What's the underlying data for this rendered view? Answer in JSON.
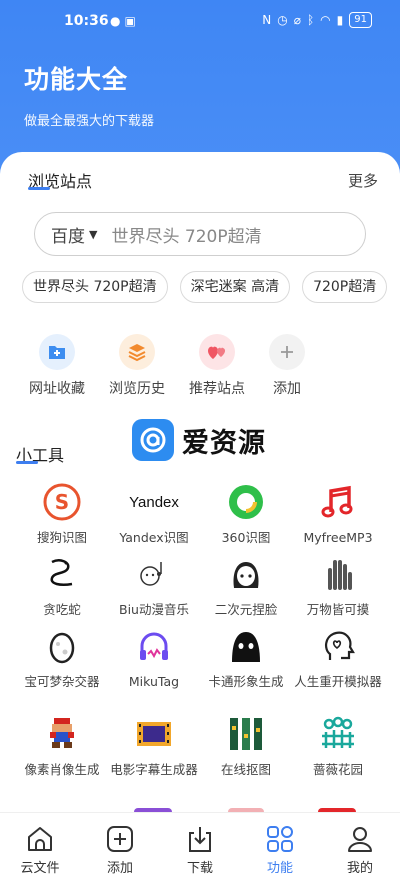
{
  "status_bar": {
    "time": "10:36",
    "battery": "91"
  },
  "header": {
    "title": "功能大全",
    "subtitle": "做最全最强大的下载器"
  },
  "browse": {
    "title": "浏览站点",
    "more": "更多",
    "search": {
      "engine": "百度",
      "query": "世界尽头 720P超清"
    },
    "chips": [
      "世界尽头 720P超清",
      "深宅迷案 高清",
      "720P超清"
    ],
    "quick": [
      {
        "label": "网址收藏",
        "icon": "bookmark-folder-icon"
      },
      {
        "label": "浏览历史",
        "icon": "history-layers-icon"
      },
      {
        "label": "推荐站点",
        "icon": "hearts-icon"
      },
      {
        "label": "添加",
        "icon": "plus-icon"
      }
    ]
  },
  "tools": {
    "title": "小工具",
    "brand": "爱资源",
    "items": [
      {
        "label": "搜狗识图",
        "icon": "sogou-icon"
      },
      {
        "label": "Yandex识图",
        "icon": "yandex-icon",
        "icon_text": "Yandex"
      },
      {
        "label": "360识图",
        "icon": "360-icon"
      },
      {
        "label": "MyfreeMP3",
        "icon": "music-note-icon"
      },
      {
        "label": "贪吃蛇",
        "icon": "snake-icon"
      },
      {
        "label": "Biu动漫音乐",
        "icon": "anime-music-icon"
      },
      {
        "label": "二次元捏脸",
        "icon": "anime-girl-icon"
      },
      {
        "label": "万物皆可摸",
        "icon": "hand-icon"
      },
      {
        "label": "宝可梦杂交器",
        "icon": "egg-icon"
      },
      {
        "label": "MikuTag",
        "icon": "headphones-icon"
      },
      {
        "label": "卡通形象生成",
        "icon": "ghost-face-icon"
      },
      {
        "label": "人生重开模拟器",
        "icon": "heart-head-icon"
      },
      {
        "label": "像素肖像生成",
        "icon": "pixel-mario-icon"
      },
      {
        "label": "电影字幕生成器",
        "icon": "film-strip-icon"
      },
      {
        "label": "在线抠图",
        "icon": "cutout-icon"
      },
      {
        "label": "蔷薇花园",
        "icon": "garden-fence-icon"
      }
    ]
  },
  "nav": [
    {
      "label": "云文件",
      "icon": "cloud-house-icon",
      "active": false
    },
    {
      "label": "添加",
      "icon": "add-square-icon",
      "active": false
    },
    {
      "label": "下载",
      "icon": "download-tray-icon",
      "active": false
    },
    {
      "label": "功能",
      "icon": "grid-apps-icon",
      "active": true
    },
    {
      "label": "我的",
      "icon": "user-icon",
      "active": false
    }
  ],
  "colors": {
    "accent": "#3d7ef0",
    "header": "#4089f5"
  }
}
